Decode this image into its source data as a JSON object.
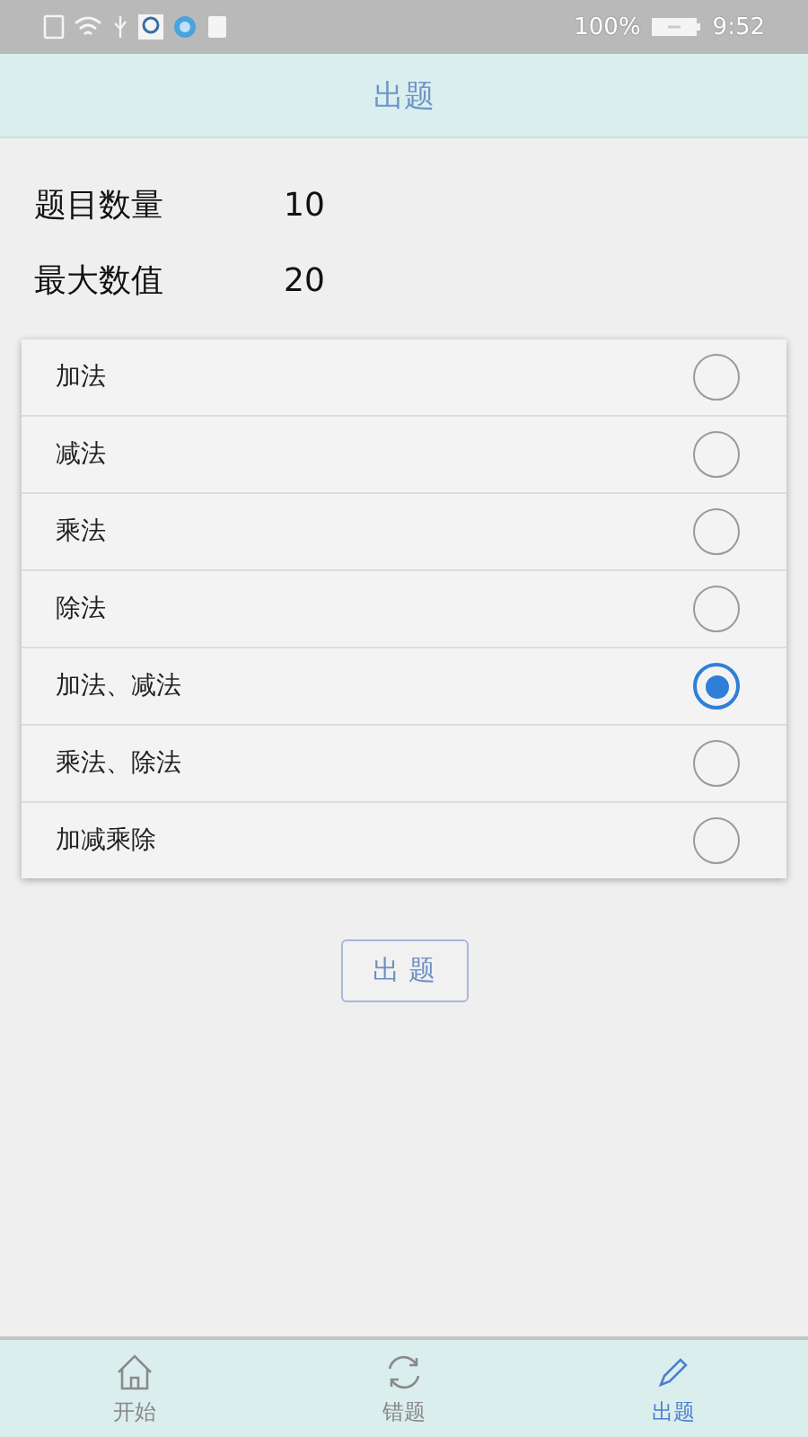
{
  "status_bar": {
    "battery": "100%",
    "time": "9:52"
  },
  "header": {
    "title": "出题"
  },
  "settings": [
    {
      "label": "题目数量",
      "value": "10"
    },
    {
      "label": "最大数值",
      "value": "20"
    }
  ],
  "options": [
    {
      "label": "加法",
      "selected": false
    },
    {
      "label": "减法",
      "selected": false
    },
    {
      "label": "乘法",
      "selected": false
    },
    {
      "label": "除法",
      "selected": false
    },
    {
      "label": "加法、减法",
      "selected": true
    },
    {
      "label": "乘法、除法",
      "selected": false
    },
    {
      "label": "加减乘除",
      "selected": false
    }
  ],
  "button": {
    "label": "出 题"
  },
  "tabs": [
    {
      "label": "开始",
      "kind": "home",
      "selected": false
    },
    {
      "label": "错题",
      "kind": "refresh",
      "selected": false
    },
    {
      "label": "出题",
      "kind": "edit",
      "selected": true
    }
  ]
}
